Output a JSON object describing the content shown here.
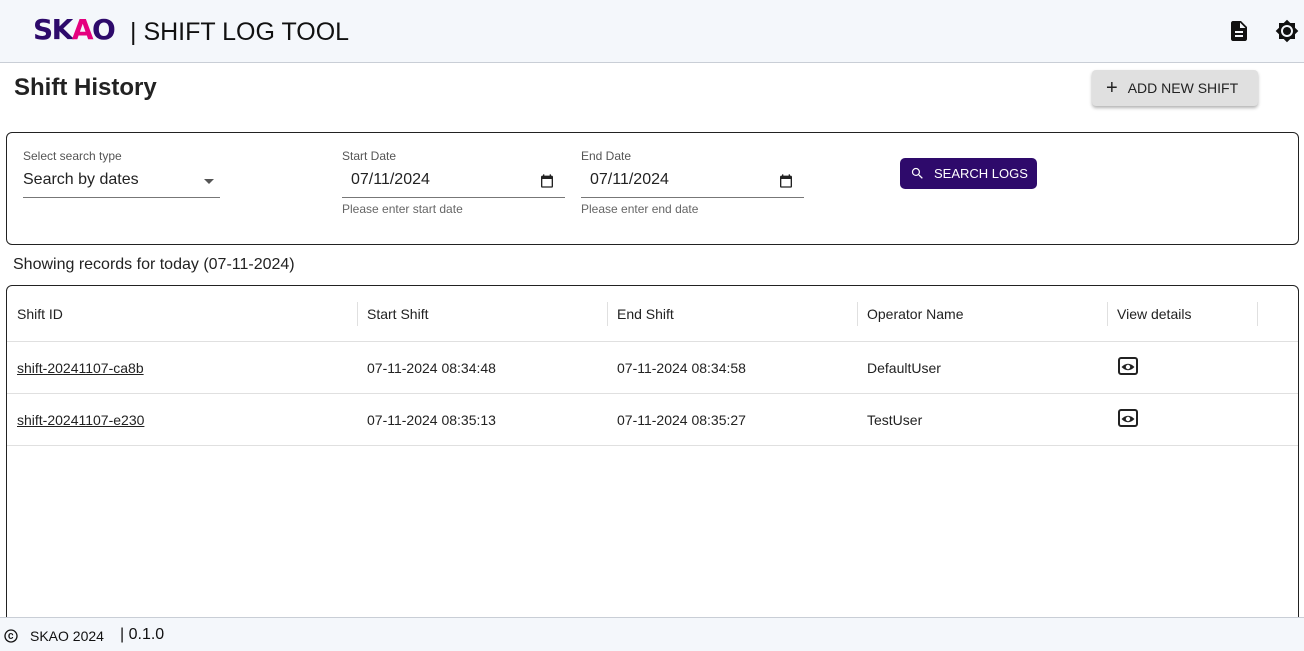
{
  "header": {
    "logo_text": "SKAO",
    "app_title": "| SHIFT LOG TOOL",
    "icons": [
      "document-icon",
      "brightness-icon"
    ]
  },
  "page": {
    "title": "Shift History",
    "add_button_label": "ADD NEW SHIFT"
  },
  "search": {
    "type_label": "Select search type",
    "type_value": "Search by dates",
    "start_label": "Start Date",
    "start_value": "07/11/2024",
    "start_helper": "Please enter start date",
    "end_label": "End Date",
    "end_value": "07/11/2024",
    "end_helper": "Please enter end date",
    "button_label": "SEARCH LOGS"
  },
  "records_text": "Showing records for today (07-11-2024)",
  "table": {
    "columns": [
      "Shift ID",
      "Start Shift",
      "End Shift",
      "Operator Name",
      "View details"
    ],
    "rows": [
      {
        "shift_id": "shift-20241107-ca8b",
        "start": "07-11-2024 08:34:48",
        "end": "07-11-2024 08:34:58",
        "operator": "DefaultUser"
      },
      {
        "shift_id": "shift-20241107-e230",
        "start": "07-11-2024 08:35:13",
        "end": "07-11-2024 08:35:27",
        "operator": "TestUser"
      }
    ]
  },
  "footer": {
    "owner": "SKAO 2024",
    "version": "| 0.1.0"
  },
  "colors": {
    "brand": "#2e0a6b",
    "accent": "#e5007e",
    "header_bg": "#f4f7fb"
  }
}
